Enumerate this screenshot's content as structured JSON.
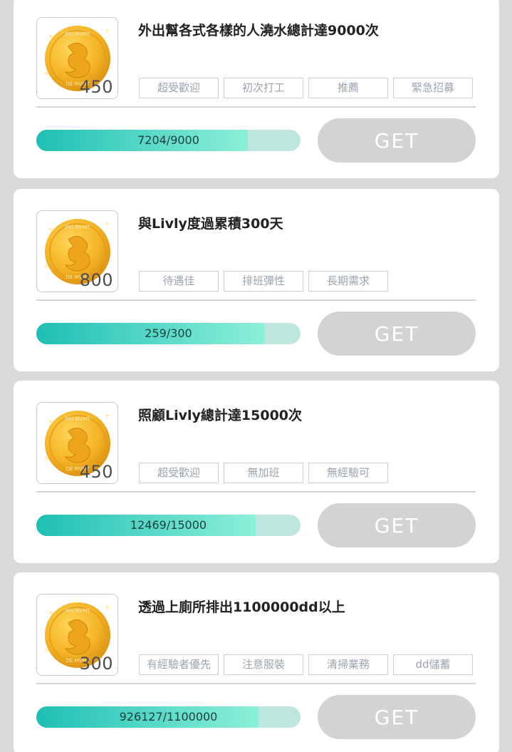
{
  "colors": {
    "background": "#dadada",
    "card": "#ffffff",
    "progress_start": "#1ebfb5",
    "progress_end": "#8cf0d8",
    "progress_track": "#bfe6de",
    "button_disabled": "#d3d3d3",
    "coin_gold": "#f5b526"
  },
  "missions": [
    {
      "reward": "450",
      "title": "外出幫各式各樣的人澆水總計達9000次",
      "tags": [
        "超受歡迎",
        "初次打工",
        "推薦",
        "緊急招募"
      ],
      "progress_text": "7204/9000",
      "progress_fraction": 0.8004,
      "button_label": "GET"
    },
    {
      "reward": "800",
      "title": "與Livly度過累積300天",
      "tags": [
        "待遇佳",
        "排班彈性",
        "長期需求"
      ],
      "progress_text": "259/300",
      "progress_fraction": 0.8633,
      "button_label": "GET"
    },
    {
      "reward": "450",
      "title": "照顧Livly總計達15000次",
      "tags": [
        "超受歡迎",
        "無加班",
        "無經驗可"
      ],
      "progress_text": "12469/15000",
      "progress_fraction": 0.8313,
      "button_label": "GET"
    },
    {
      "reward": "300",
      "title": "透過上廁所排出1100000dd以上",
      "tags": [
        "有經驗者優先",
        "注意服裝",
        "清掃業務",
        "dd儲蓄"
      ],
      "progress_text": "926127/1100000",
      "progress_fraction": 0.8419,
      "button_label": "GET"
    }
  ]
}
